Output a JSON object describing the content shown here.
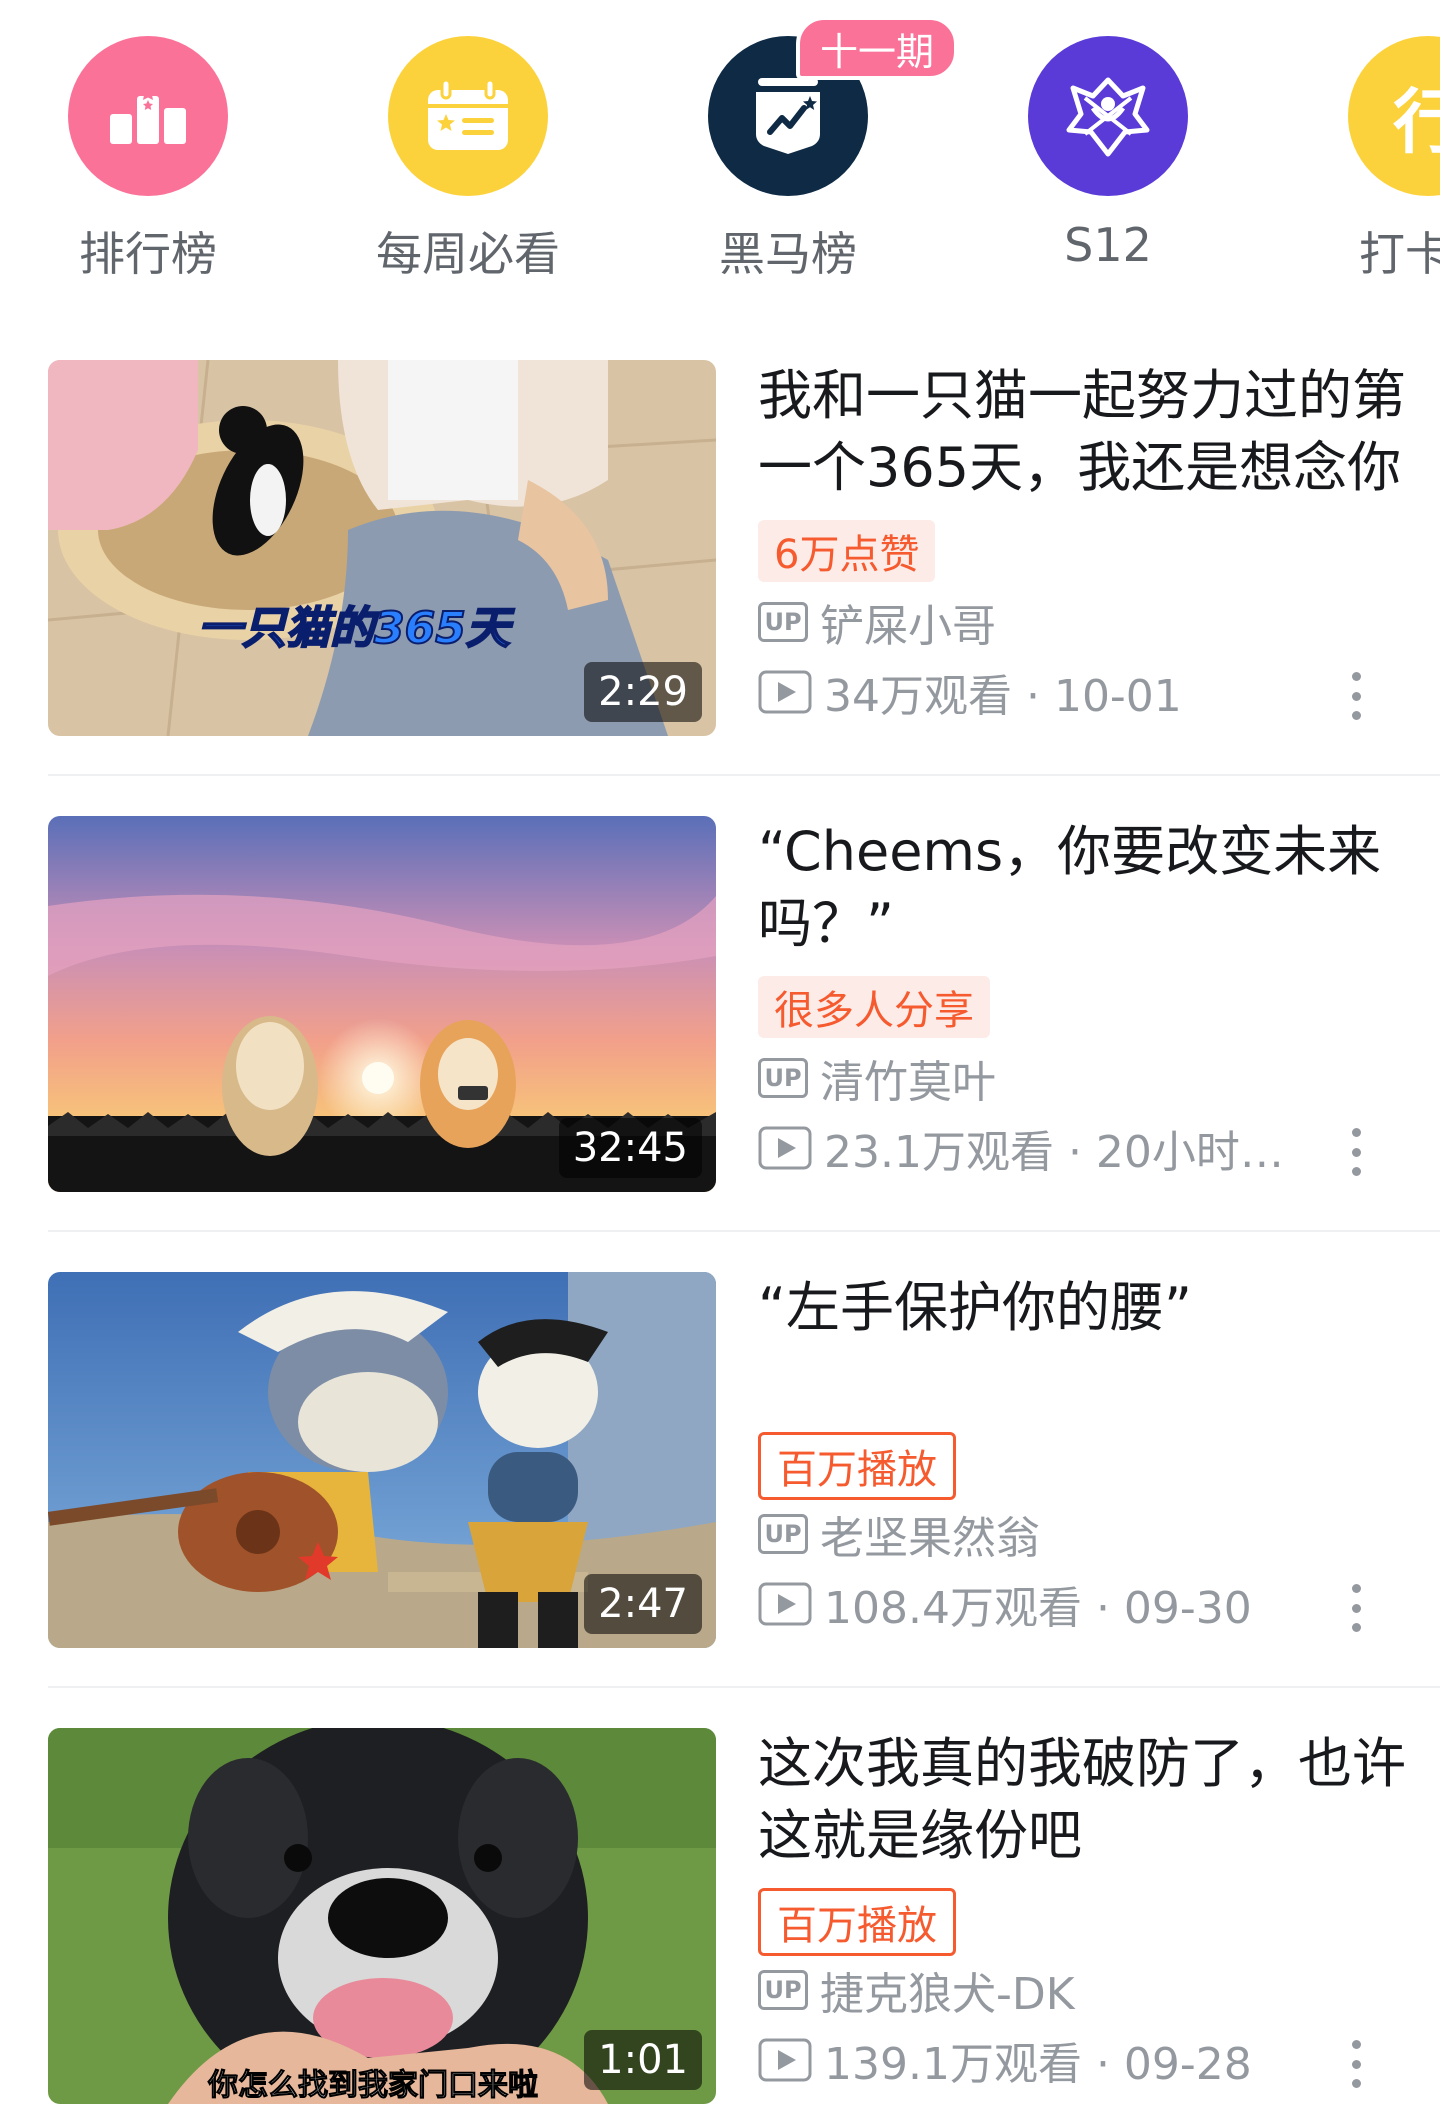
{
  "categories": [
    {
      "label": "排行榜",
      "color": "#fb7299",
      "icon": "ranking-podium-icon"
    },
    {
      "label": "每周必看",
      "color": "#fcd23c",
      "icon": "calendar-star-icon"
    },
    {
      "label": "黑马榜",
      "color": "#0e2a45",
      "icon": "trend-shield-icon",
      "badge": "十一期"
    },
    {
      "label": "S12",
      "color": "#5a3bd8",
      "icon": "s12-emblem-icon"
    },
    {
      "label": "打卡中",
      "color": "#fcd23c",
      "icon": "checkin-icon",
      "glyph": "行"
    }
  ],
  "videos": [
    {
      "title": "我和一只猫一起努力过的第一个365天，我还是想念你",
      "tag": "6万点赞",
      "tag_style": "soft",
      "uploader": "铲屎小哥",
      "up_label": "UP",
      "stats": "34万观看 · 10-01",
      "duration": "2:29",
      "thumb_caption": "一只猫的365天"
    },
    {
      "title": "“Cheems，你要改变未来吗？”",
      "tag": "很多人分享",
      "tag_style": "soft",
      "uploader": "清竹莫叶",
      "up_label": "UP",
      "stats": "23.1万观看 · 20小时…",
      "duration": "32:45"
    },
    {
      "title": "“左手保护你的腰”",
      "tag": "百万播放",
      "tag_style": "outline",
      "uploader": "老坚果然翁",
      "up_label": "UP",
      "stats": "108.4万观看 · 09-30",
      "duration": "2:47"
    },
    {
      "title": "这次我真的我破防了，也许这就是缘份吧",
      "tag": "百万播放",
      "tag_style": "outline",
      "uploader": "捷克狼犬-DK",
      "up_label": "UP",
      "stats": "139.1万观看 · 09-28",
      "duration": "1:01",
      "thumb_caption": "你怎么找到我家门口来啦"
    }
  ]
}
